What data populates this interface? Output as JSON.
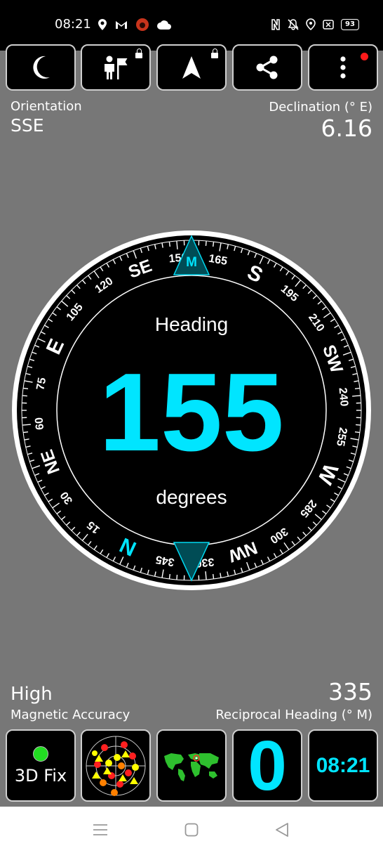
{
  "status_bar": {
    "time": "08:21",
    "battery": "93"
  },
  "toolbar": {
    "night_mode": "moon-icon",
    "landmark": "person-flag-icon",
    "navigate": "navigation-arrow-icon",
    "share": "share-icon",
    "more": "more-vert-icon"
  },
  "info": {
    "orientation_label": "Orientation",
    "orientation_value": "SSE",
    "declination_label": "Declination (° E)",
    "declination_value": "6.16",
    "accuracy_value": "High",
    "accuracy_label": "Magnetic Accuracy",
    "reciprocal_value": "335",
    "reciprocal_label": "Reciprocal Heading (° M)"
  },
  "compass": {
    "heading_label": "Heading",
    "heading_value": "155",
    "units_label": "degrees",
    "marker_label": "M",
    "heading_deg": 155,
    "cardinals": [
      {
        "text": "N",
        "deg": 0
      },
      {
        "text": "NE",
        "deg": 45
      },
      {
        "text": "E",
        "deg": 90
      },
      {
        "text": "SE",
        "deg": 135
      },
      {
        "text": "S",
        "deg": 180
      },
      {
        "text": "SW",
        "deg": 225
      },
      {
        "text": "W",
        "deg": 270
      },
      {
        "text": "NW",
        "deg": 315
      }
    ],
    "numbers": [
      {
        "text": "15",
        "deg": 15
      },
      {
        "text": "30",
        "deg": 30
      },
      {
        "text": "60",
        "deg": 60
      },
      {
        "text": "75",
        "deg": 75
      },
      {
        "text": "105",
        "deg": 105
      },
      {
        "text": "120",
        "deg": 120
      },
      {
        "text": "150",
        "deg": 150
      },
      {
        "text": "165",
        "deg": 165
      },
      {
        "text": "195",
        "deg": 195
      },
      {
        "text": "210",
        "deg": 210
      },
      {
        "text": "240",
        "deg": 240
      },
      {
        "text": "255",
        "deg": 255
      },
      {
        "text": "285",
        "deg": 285
      },
      {
        "text": "300",
        "deg": 300
      },
      {
        "text": "330",
        "deg": 330
      },
      {
        "text": "345",
        "deg": 345
      }
    ]
  },
  "bottom_bar": {
    "gps_fix_label": "3D Fix",
    "satellites": "satellite-sky-icon",
    "world_map": "world-map-icon",
    "big_counter": "0",
    "clock": "08:21"
  },
  "colors": {
    "accent": "#00e5ff",
    "background": "#777777",
    "dial": "#000000",
    "fix_dot": "#22dd22"
  }
}
